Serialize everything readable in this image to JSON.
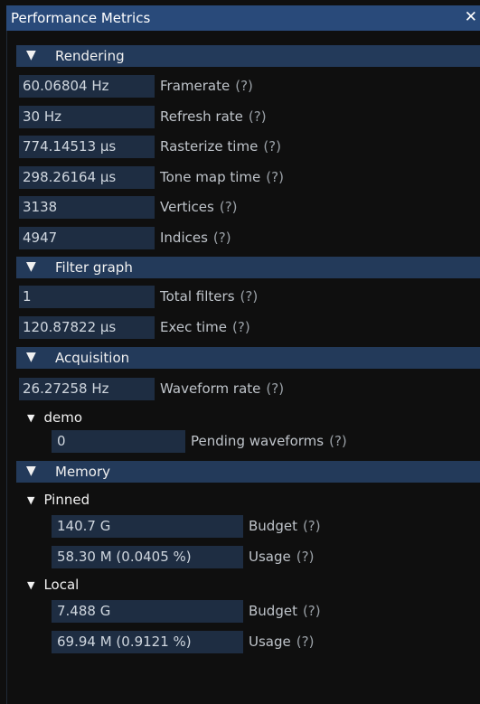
{
  "window": {
    "title": "Performance Metrics",
    "close_glyph": "✕"
  },
  "rendering": {
    "header": "Rendering",
    "rows": [
      {
        "value": "60.06804 Hz",
        "label": "Framerate"
      },
      {
        "value": "30 Hz",
        "label": "Refresh rate"
      },
      {
        "value": "774.14513 µs",
        "label": "Rasterize time"
      },
      {
        "value": "298.26164 µs",
        "label": "Tone map time"
      },
      {
        "value": "3138",
        "label": "Vertices"
      },
      {
        "value": "4947",
        "label": "Indices"
      }
    ]
  },
  "filter_graph": {
    "header": "Filter graph",
    "rows": [
      {
        "value": "1",
        "label": "Total filters"
      },
      {
        "value": "120.87822 µs",
        "label": "Exec time"
      }
    ]
  },
  "acquisition": {
    "header": "Acquisition",
    "rows": [
      {
        "value": "26.27258 Hz",
        "label": "Waveform rate"
      }
    ],
    "demo": {
      "header": "demo",
      "rows": [
        {
          "value": "0",
          "label": "Pending waveforms"
        }
      ]
    }
  },
  "memory": {
    "header": "Memory",
    "pinned": {
      "header": "Pinned",
      "rows": [
        {
          "value": "140.7 G",
          "label": "Budget"
        },
        {
          "value": "58.30 M (0.0405 %)",
          "label": "Usage"
        }
      ]
    },
    "local": {
      "header": "Local",
      "rows": [
        {
          "value": "7.488 G",
          "label": "Budget"
        },
        {
          "value": "69.94 M (0.9121 %)",
          "label": "Usage"
        }
      ]
    }
  },
  "help_marker": "(?)",
  "tri_open": "▼",
  "colors": {
    "title_bg": "#294a7a",
    "section_bg": "#233a5a",
    "field_bg": "#1e2d42",
    "window_bg": "#0f0f0f"
  }
}
